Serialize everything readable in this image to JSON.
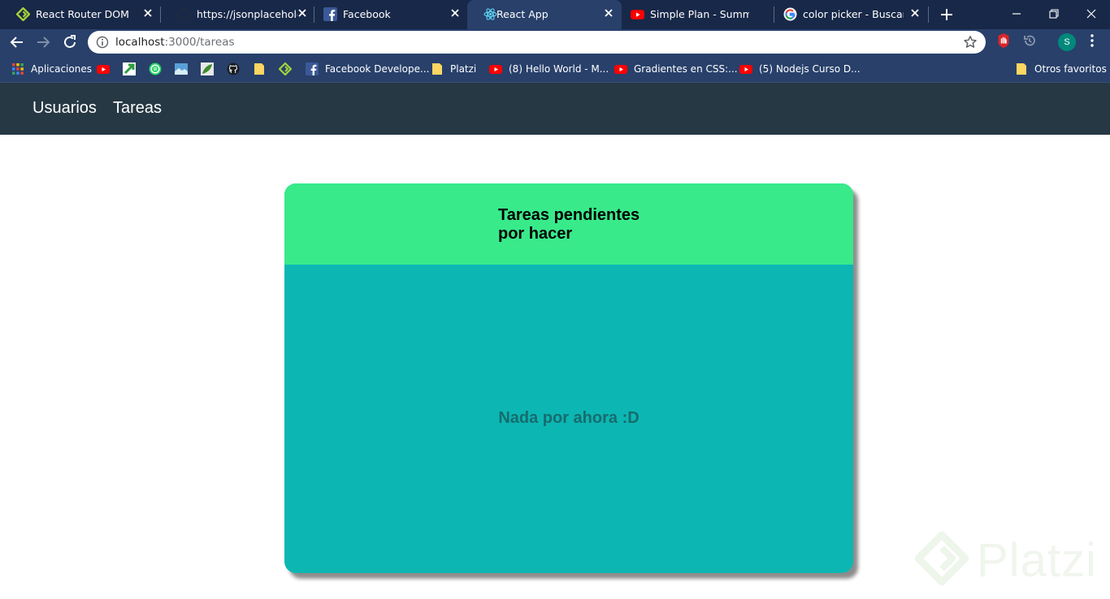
{
  "browser": {
    "tabs": [
      {
        "title": "React Router DOM",
        "icon": "react-router-icon",
        "active": false
      },
      {
        "title": "https://jsonplaceholder.",
        "icon": "github-icon",
        "active": false
      },
      {
        "title": "Facebook",
        "icon": "facebook-icon",
        "active": false
      },
      {
        "title": "React App",
        "icon": "react-icon",
        "active": true
      },
      {
        "title": "Simple Plan - Summer P",
        "icon": "youtube-icon",
        "active": false
      },
      {
        "title": "color picker - Buscar co",
        "icon": "google-icon",
        "active": false
      }
    ],
    "address": {
      "host": "localhost",
      "path": ":3000/tareas"
    },
    "profile_initial": "S",
    "bookmarks": [
      {
        "label": "Aplicaciones",
        "icon": "apps-grid-icon"
      },
      {
        "label": "",
        "icon": "youtube-icon"
      },
      {
        "label": "",
        "icon": "green-arrow-icon"
      },
      {
        "label": "",
        "icon": "whatsapp-icon"
      },
      {
        "label": "",
        "icon": "landscape-icon"
      },
      {
        "label": "",
        "icon": "leaf-icon"
      },
      {
        "label": "",
        "icon": "github-icon"
      },
      {
        "label": "",
        "icon": "folder-icon"
      },
      {
        "label": "",
        "icon": "react-router-icon"
      },
      {
        "label": "Facebook Develope...",
        "icon": "facebook-icon"
      },
      {
        "label": "Platzi",
        "icon": "folder-icon"
      },
      {
        "label": "(8) Hello World - M...",
        "icon": "youtube-icon"
      },
      {
        "label": "Gradientes en CSS:...",
        "icon": "youtube-icon"
      },
      {
        "label": "(5) Nodejs Curso D...",
        "icon": "youtube-icon"
      },
      {
        "label": "Otros favoritos",
        "icon": "folder-icon"
      }
    ]
  },
  "app": {
    "nav": {
      "usuarios": "Usuarios",
      "tareas": "Tareas"
    },
    "card": {
      "title": "Tareas pendientes por hacer",
      "empty_message": "Nada por ahora :D"
    },
    "watermark": "Platzi"
  },
  "colors": {
    "tabstrip": "#182848",
    "toolbar": "#28406a",
    "appnav": "#263844",
    "card_header": "#38ea8a",
    "card_body": "#0cb7b3",
    "empty_text": "#166c6e"
  }
}
